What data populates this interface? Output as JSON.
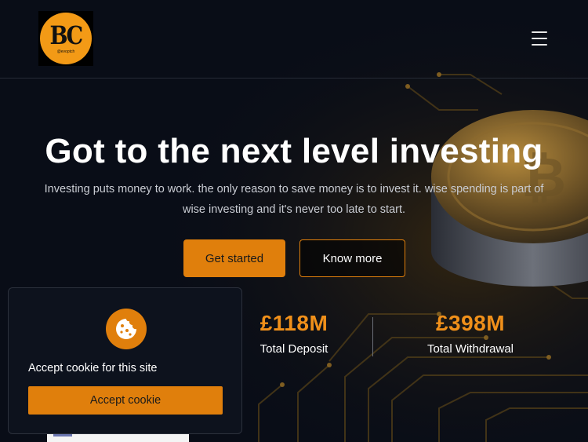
{
  "header": {
    "logo": {
      "letters": "BC",
      "handle": "@evoptch"
    },
    "menu_icon": "hamburger-menu-icon"
  },
  "hero": {
    "title": "Got to the next level investing",
    "subtitle": "Investing puts money to work. the only reason to save money is to invest it. wise spending is part of wise investing and it's never too late to start.",
    "primary_button": "Get started",
    "secondary_button": "Know more"
  },
  "stats": [
    {
      "value": "£118M",
      "label": "Total Deposit"
    },
    {
      "value": "£398M",
      "label": "Total Withdrawal"
    }
  ],
  "cookie": {
    "icon": "cookie-icon",
    "message": "Accept cookie for this site",
    "button": "Accept cookie"
  },
  "colors": {
    "accent": "#e07f0c",
    "background": "#090d17",
    "stat_value": "#f0901a"
  }
}
